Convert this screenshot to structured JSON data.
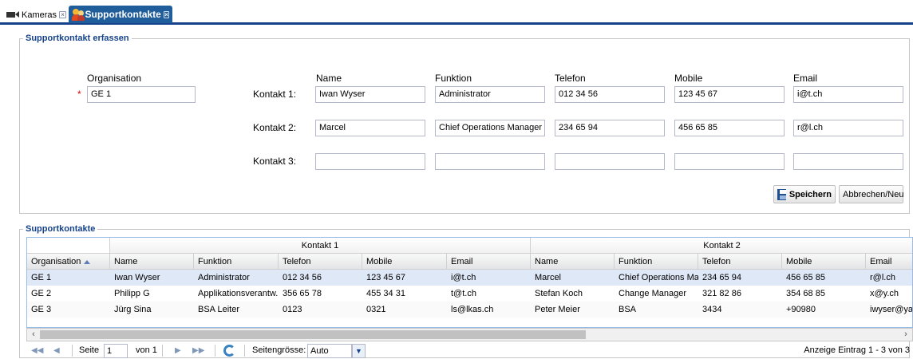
{
  "tabs": [
    {
      "label": "Kameras",
      "icon": "camera-icon",
      "active": false
    },
    {
      "label": "Supportkontakte",
      "icon": "people-icon",
      "active": true
    }
  ],
  "form": {
    "title": "Supportkontakt erfassen",
    "org_label": "Organisation",
    "org_value": "GE 1",
    "required_mark": "*",
    "headers": {
      "name": "Name",
      "function": "Funktion",
      "phone": "Telefon",
      "mobile": "Mobile",
      "email": "Email"
    },
    "contacts": [
      {
        "label": "Kontakt 1:",
        "name": "Iwan Wyser",
        "function": "Administrator",
        "phone": "012 34 56",
        "mobile": "123 45 67",
        "email": "i@t.ch"
      },
      {
        "label": "Kontakt 2:",
        "name": "Marcel",
        "function": "Chief Operations Manager",
        "phone": "234 65 94",
        "mobile": "456 65 85",
        "email": "r@l.ch"
      },
      {
        "label": "Kontakt 3:",
        "name": "",
        "function": "",
        "phone": "",
        "mobile": "",
        "email": ""
      }
    ],
    "save_label": "Speichern",
    "cancel_label": "Abbrechen/Neu"
  },
  "grid": {
    "title": "Supportkontakte",
    "groups": [
      "Kontakt 1",
      "Kontakt 2"
    ],
    "columns": [
      "Organisation",
      "Name",
      "Funktion",
      "Telefon",
      "Mobile",
      "Email",
      "Name",
      "Funktion",
      "Telefon",
      "Mobile",
      "Email"
    ],
    "rows": [
      [
        "GE 1",
        "Iwan Wyser",
        "Administrator",
        "012 34 56",
        "123 45 67",
        "i@t.ch",
        "Marcel",
        "Chief Operations Ma...",
        "234 65 94",
        "456 65 85",
        "r@l.ch"
      ],
      [
        "GE 2",
        "Philipp G",
        "Applikationsverantw...",
        "356 65 78",
        "455 34 31",
        "t@t.ch",
        "Stefan Koch",
        "Change Manager",
        "321 82 86",
        "354 68 85",
        "x@y.ch"
      ],
      [
        "GE 3",
        "Jürg Sina",
        "BSA Leiter",
        "0123",
        "0321",
        "ls@lkas.ch",
        "Peter Meier",
        "BSA",
        "3434",
        "+90980",
        "iwyser@yal"
      ]
    ]
  },
  "pager": {
    "page_label": "Seite",
    "page_value": "1",
    "of_label": "von 1",
    "page_size_label": "Seitengrösse:",
    "page_size_value": "Auto",
    "status": "Anzeige Eintrag 1 - 3 von 3"
  }
}
